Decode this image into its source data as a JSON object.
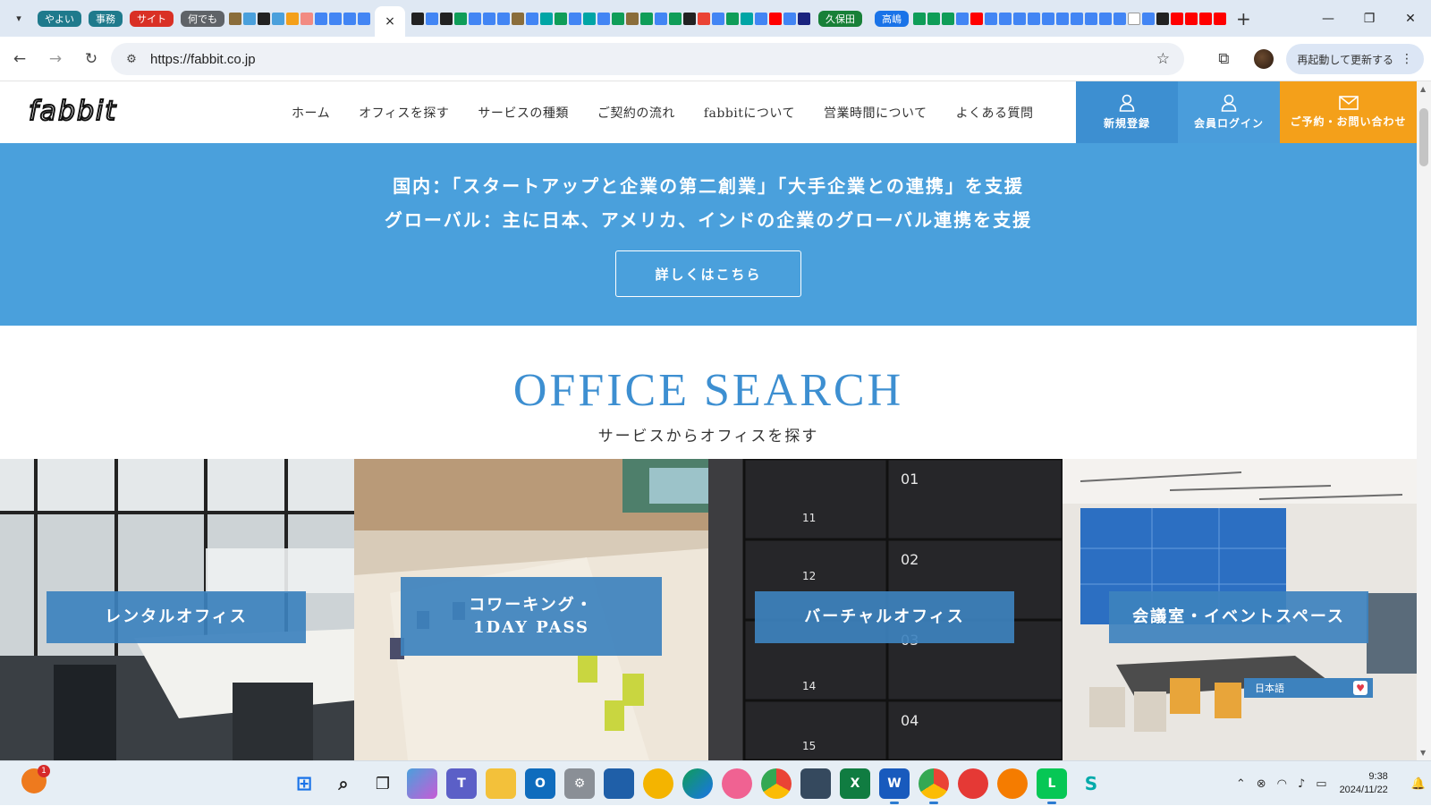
{
  "browser": {
    "tab_groups": [
      {
        "label": "やよい",
        "color": "#1f7a8c"
      },
      {
        "label": "事務",
        "color": "#1f7a8c"
      },
      {
        "label": "サイト",
        "color": "#d93025"
      },
      {
        "label": "何でも",
        "color": "#5f6368"
      }
    ],
    "tab_groups_right": [
      {
        "label": "久保田",
        "color": "#188038"
      },
      {
        "label": "高嶋",
        "color": "#1a73e8"
      }
    ],
    "active_tab_close": "×",
    "new_tab": "+",
    "window_controls": {
      "minimize": "—",
      "restore": "❐",
      "close": "✕"
    },
    "url": "https://fabbit.co.jp",
    "relaunch_label": "再起動して更新する"
  },
  "site": {
    "logo": "fabbit",
    "nav": [
      "ホーム",
      "オフィスを探す",
      "サービスの種類",
      "ご契約の流れ",
      "fabbitについて",
      "営業時間について",
      "よくある質問"
    ],
    "header_buttons": {
      "register": "新規登録",
      "login": "会員ログイン",
      "contact": "ご予約・お問い合わせ"
    },
    "colors": {
      "blue": "#4aa0dc",
      "dark_blue": "#3d8fd1",
      "orange": "#f4a01a"
    },
    "hero": {
      "line1": "国内：「スタートアップと企業の第二創業」「大手企業との連携」を支援",
      "line2": "グローバル：主に日本、アメリカ、インドの企業のグローバル連携を支援",
      "button": "詳しくはこちら"
    },
    "office_search": {
      "title": "OFFICE SEARCH",
      "subtitle": "サービスからオフィスを探す",
      "cards": [
        {
          "label": "レンタルオフィス"
        },
        {
          "label_line1": "コワーキング・",
          "label_line2": "1DAY PASS"
        },
        {
          "label": "バーチャルオフィス"
        },
        {
          "label": "会議室・イベントスペース"
        }
      ],
      "language_widget": "日本語"
    }
  },
  "taskbar": {
    "notification_count": "1",
    "time": "9:38",
    "date": "2024/11/22"
  }
}
